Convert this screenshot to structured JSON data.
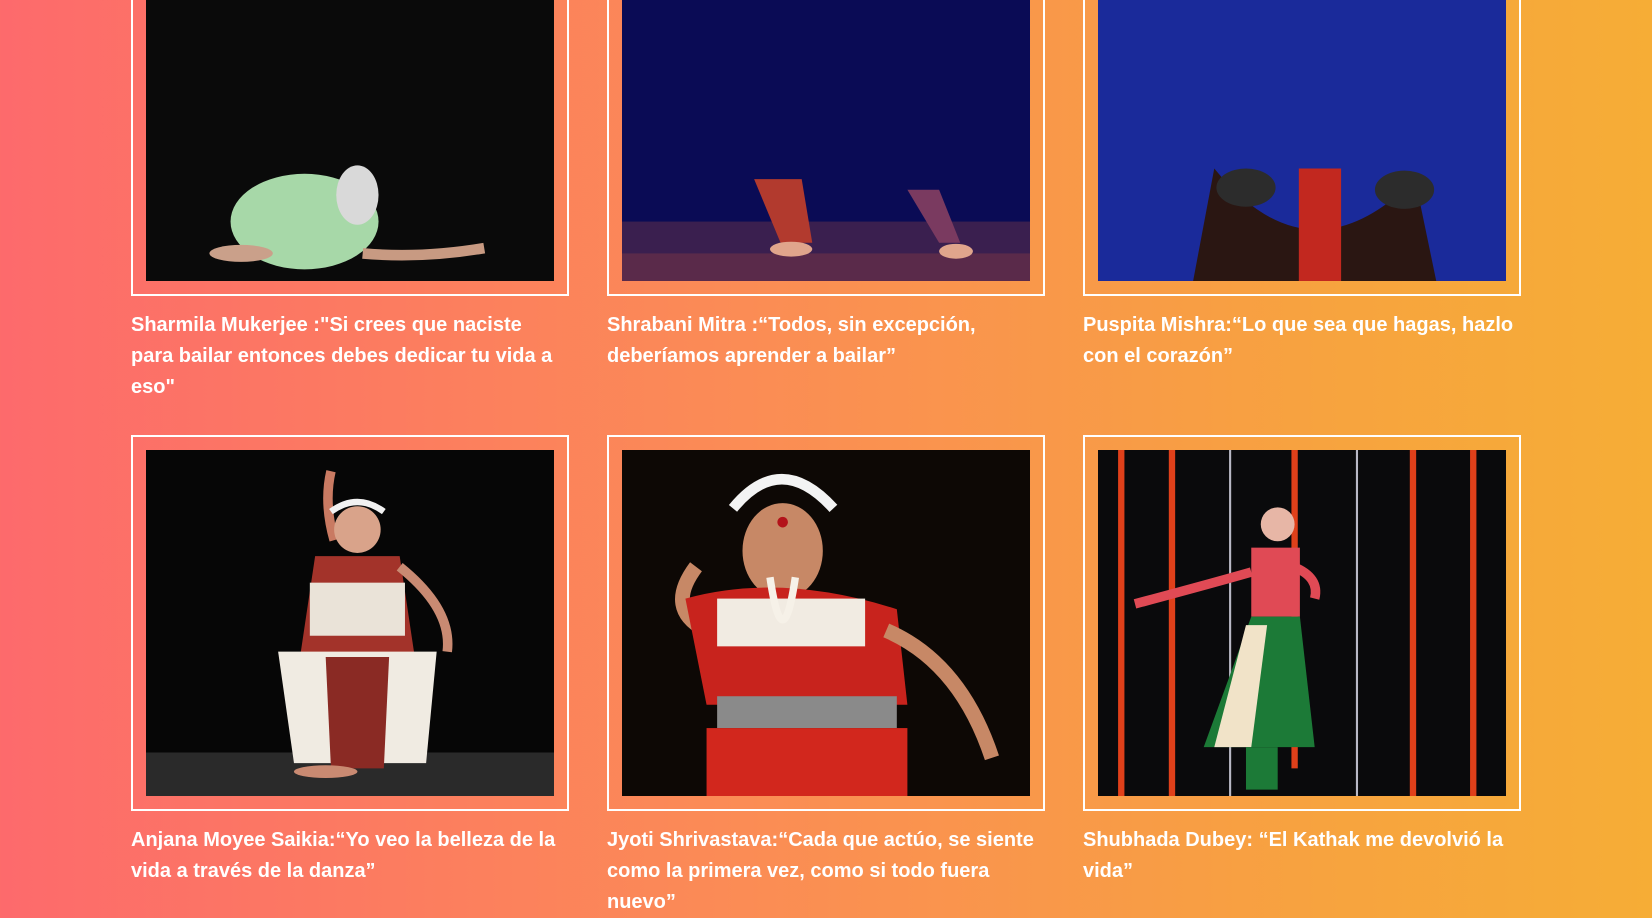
{
  "gallery": {
    "cards": [
      {
        "caption": "Sharmila Mukerjee :\"Si crees que naciste para bailar entonces debes dedicar tu vida a eso\"",
        "image": "dancer-kneeling-photo"
      },
      {
        "caption": "Shrabani Mitra :“Todos, sin excepción, deberíamos aprender a bailar”",
        "image": "dancer-stage-feet-photo"
      },
      {
        "caption": "Puspita Mishra:“Lo que sea que hagas, hazlo con el corazón”",
        "image": "dancer-blue-stage-photo"
      },
      {
        "caption": "Anjana Moyee Saikia:“Yo veo la belleza de la vida a través de la danza”",
        "image": "odissi-dancer-photo"
      },
      {
        "caption": "Jyoti Shrivastava:“Cada que actúo, se siente como la primera vez, como si todo fuera nuevo”",
        "image": "odissi-dancer-portrait-photo"
      },
      {
        "caption": "Shubhada Dubey: “El Kathak me devolvió la vida”",
        "image": "kathak-dancer-photo"
      }
    ]
  },
  "colors": {
    "gradient_start": "#fd6a6c",
    "gradient_end": "#f6ad36",
    "frame_border": "#ffffff",
    "caption_text": "#ffffff"
  }
}
